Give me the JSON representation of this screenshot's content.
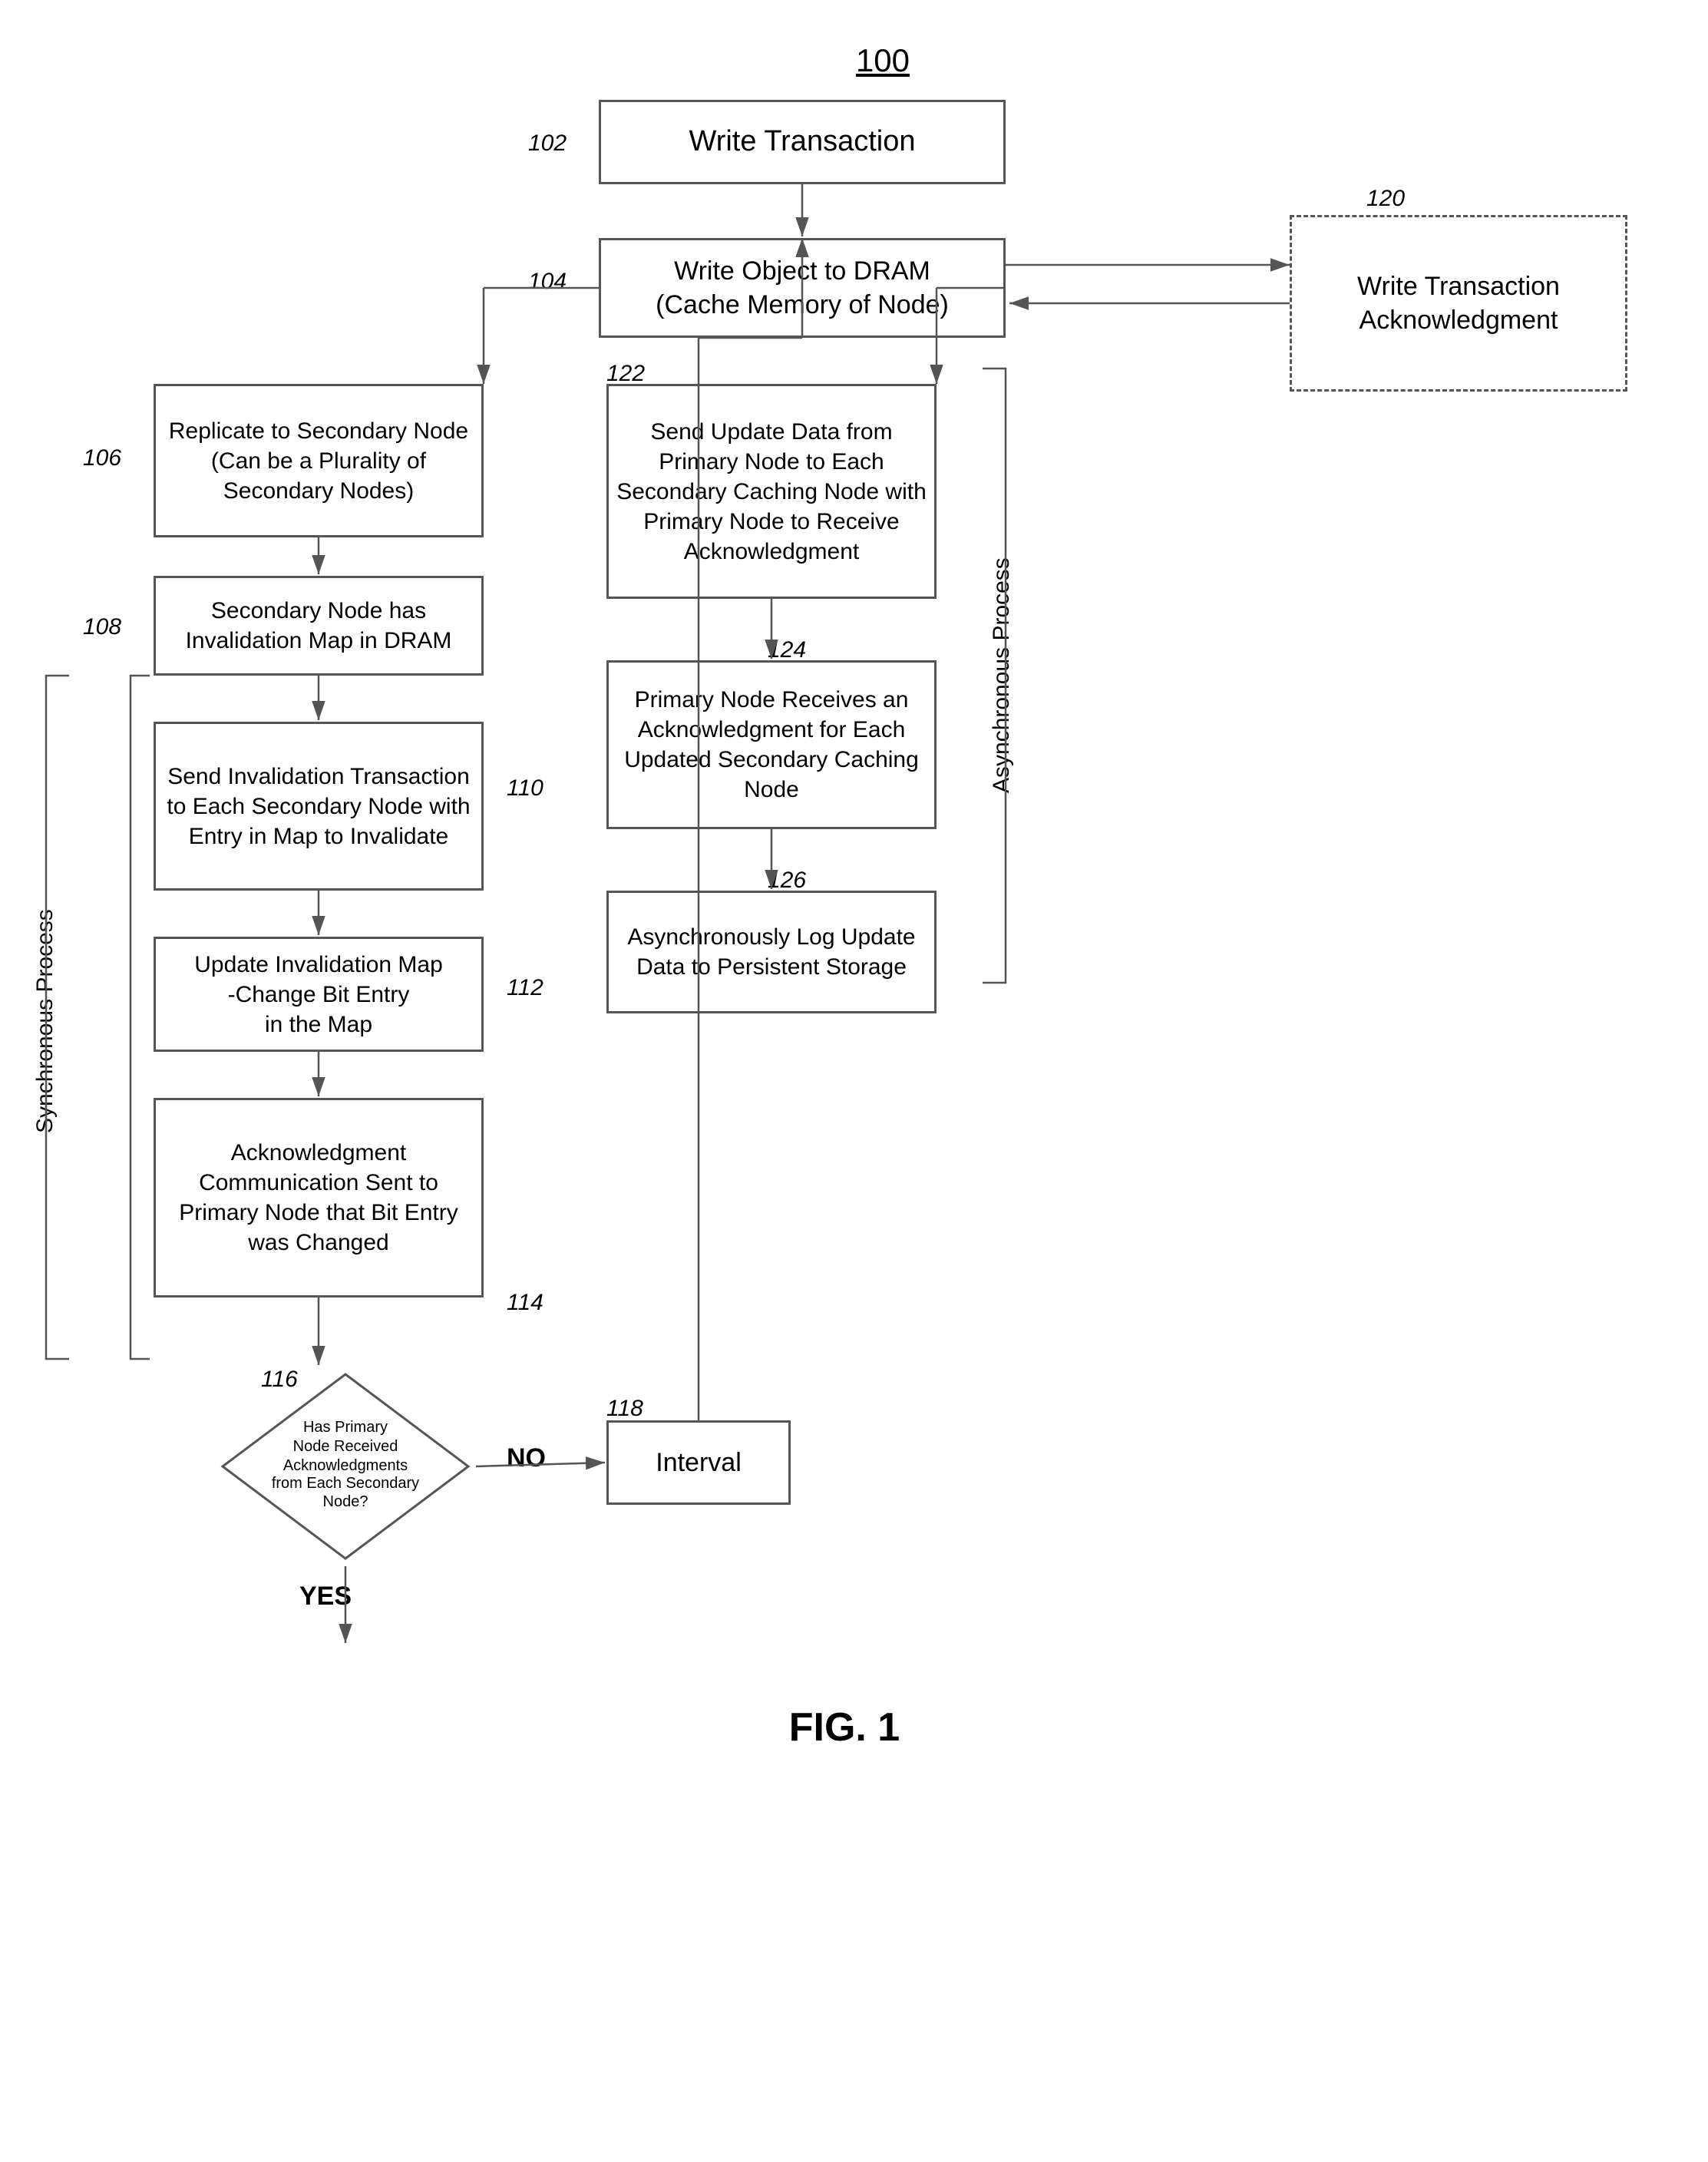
{
  "diagram": {
    "title": "100",
    "fig": "FIG. 1",
    "nodes": {
      "n100": {
        "label": "100"
      },
      "n102_label": "102",
      "n104_label": "104",
      "n106_label": "106",
      "n108_label": "108",
      "n110_label": "110",
      "n112_label": "112",
      "n114_label": "114",
      "n116_label": "116",
      "n118_label": "118",
      "n120_label": "120",
      "n122_label": "122",
      "n124_label": "124",
      "n126_label": "126"
    },
    "boxes": {
      "write_transaction": "Write Transaction",
      "write_object_dram": "Write Object to DRAM\n(Cache Memory of Node)",
      "write_transaction_ack": "Write Transaction\nAcknowledgment",
      "replicate_secondary": "Replicate to Secondary Node (Can be a Plurality of Secondary Nodes)",
      "secondary_node_invalidation": "Secondary Node has Invalidation Map in DRAM",
      "send_invalidation": "Send Invalidation Transaction to Each Secondary Node with Entry in Map to Invalidate",
      "update_invalidation_map": "Update Invalidation Map\n-Change Bit Entry\nin the Map",
      "ack_comm": "Acknowledgment Communication Sent to Primary Node that Bit Entry was Changed",
      "has_primary_node": "Has Primary\nNode Received\nAcknowledgments\nfrom Each Secondary\nNode?",
      "interval": "Interval",
      "send_update_data": "Send Update Data from Primary Node to Each Secondary Caching Node with Primary Node to Receive Acknowledgment",
      "primary_receives_ack": "Primary Node Receives an Acknowledgment for Each Updated Secondary Caching Node",
      "async_log": "Asynchronously Log Update Data to Persistent Storage",
      "yes_label": "YES",
      "no_label": "NO",
      "synchronous_label": "Synchronous Process",
      "asynchronous_label": "Asynchronous Process"
    }
  }
}
